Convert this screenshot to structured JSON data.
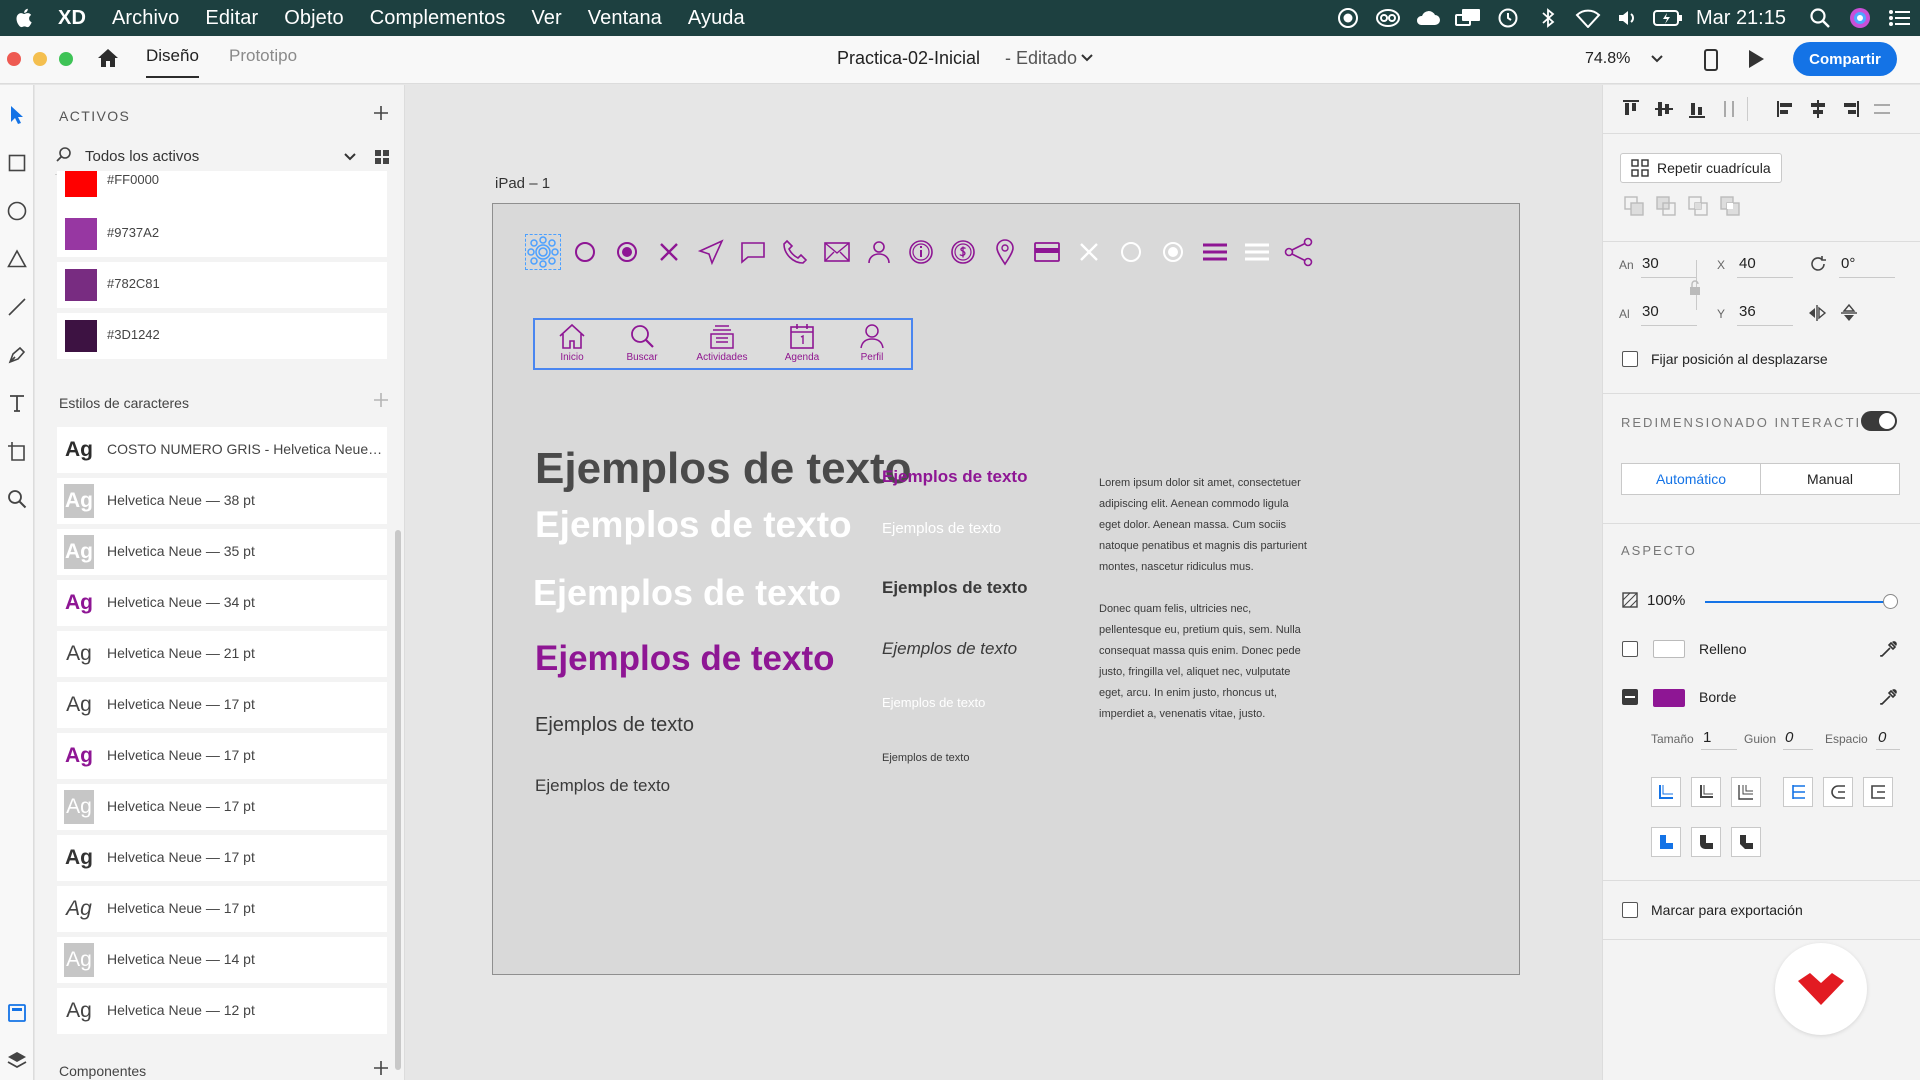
{
  "menubar": {
    "app": "XD",
    "items": [
      "Archivo",
      "Editar",
      "Objeto",
      "Complementos",
      "Ver",
      "Ventana",
      "Ayuda"
    ],
    "clock": "Mar 21:15"
  },
  "toolbar": {
    "tabs": {
      "design": "Diseño",
      "prototype": "Prototipo"
    },
    "document_title": "Practica-02-Inicial",
    "document_state": "- Editado",
    "zoom": "74.8%",
    "share_label": "Compartir"
  },
  "assets": {
    "title": "ACTIVOS",
    "filter": "Todos los activos",
    "colors": [
      {
        "hex": "#FF0000",
        "label": "#FF0000"
      },
      {
        "hex": "#9737A2",
        "label": "#9737A2"
      },
      {
        "hex": "#782C81",
        "label": "#782C81"
      },
      {
        "hex": "#3D1242",
        "label": "#3D1242"
      }
    ],
    "char_styles_title": "Estilos de caracteres",
    "char_styles": [
      {
        "ag": "Ag",
        "label": "COSTO NUMERO GRIS - Helvetica Neue…",
        "color": "#2c2c2c",
        "weight": "bold",
        "style": "normal",
        "bg": "#ffffff"
      },
      {
        "ag": "Ag",
        "label": "Helvetica Neue — 38 pt",
        "color": "#ffffff",
        "weight": "bold",
        "style": "normal",
        "bg": "#c6c6c6"
      },
      {
        "ag": "Ag",
        "label": "Helvetica Neue — 35 pt",
        "color": "#ffffff",
        "weight": "bold",
        "style": "normal",
        "bg": "#c6c6c6"
      },
      {
        "ag": "Ag",
        "label": "Helvetica Neue — 34 pt",
        "color": "#8e1694",
        "weight": "bold",
        "style": "normal",
        "bg": "#ffffff"
      },
      {
        "ag": "Ag",
        "label": "Helvetica Neue — 21 pt",
        "color": "#444444",
        "weight": "normal",
        "style": "normal",
        "bg": "#ffffff"
      },
      {
        "ag": "Ag",
        "label": "Helvetica Neue — 17 pt",
        "color": "#444444",
        "weight": "normal",
        "style": "normal",
        "bg": "#ffffff"
      },
      {
        "ag": "Ag",
        "label": "Helvetica Neue — 17 pt",
        "color": "#8e1694",
        "weight": "bold",
        "style": "normal",
        "bg": "#ffffff"
      },
      {
        "ag": "Ag",
        "label": "Helvetica Neue — 17 pt",
        "color": "#ffffff",
        "weight": "normal",
        "style": "normal",
        "bg": "#c6c6c6"
      },
      {
        "ag": "Ag",
        "label": "Helvetica Neue — 17 pt",
        "color": "#333333",
        "weight": "bold",
        "style": "normal",
        "bg": "#ffffff"
      },
      {
        "ag": "Ag",
        "label": "Helvetica Neue — 17 pt",
        "color": "#444444",
        "weight": "normal",
        "style": "italic",
        "bg": "#ffffff"
      },
      {
        "ag": "Ag",
        "label": "Helvetica Neue — 14 pt",
        "color": "#ffffff",
        "weight": "normal",
        "style": "normal",
        "bg": "#c6c6c6"
      },
      {
        "ag": "Ag",
        "label": "Helvetica Neue — 12 pt",
        "color": "#444444",
        "weight": "normal",
        "style": "normal",
        "bg": "#ffffff"
      }
    ],
    "components_title": "Componentes"
  },
  "artboard": {
    "name": "iPad – 1",
    "accent": "#8e1694",
    "icons": [
      "cluster-icon",
      "circle-outline-icon",
      "circle-filled-icon",
      "x-icon",
      "send-icon",
      "chat-icon",
      "phone-icon",
      "mail-icon",
      "user-icon",
      "info-icon",
      "dollar-icon",
      "pin-icon",
      "card-icon",
      "x-white-icon",
      "circle-white-icon",
      "radio-white-icon",
      "menu-icon",
      "menu-white-icon",
      "share-icon"
    ],
    "tabbar": [
      "Inicio",
      "Buscar",
      "Actividades",
      "Agenda",
      "Perfil"
    ],
    "samples_left": [
      "Ejemplos de texto",
      "Ejemplos de texto",
      "Ejemplos de texto",
      "Ejemplos de texto",
      "Ejemplos de texto",
      "Ejemplos de texto"
    ],
    "samples_mid": [
      "Ejemplos de texto",
      "Ejemplos de texto",
      "Ejemplos de texto",
      "Ejemplos de texto",
      "Ejemplos de texto",
      "Ejemplos de texto"
    ],
    "lorem_1": "Lorem ipsum dolor sit amet, consectetuer adipiscing elit. Aenean commodo ligula eget dolor. Aenean massa. Cum sociis natoque penatibus et magnis dis parturient montes, nascetur ridiculus mus.",
    "lorem_2": "Donec quam felis, ultricies nec, pellentesque eu, pretium quis, sem. Nulla consequat massa quis enim. Donec pede justo, fringilla vel, aliquet nec, vulputate eget, arcu. In enim justo, rhoncus ut, imperdiet a, venenatis vitae, justo."
  },
  "props": {
    "repeat_grid": "Repetir cuadrícula",
    "width_label": "An",
    "width": "30",
    "height_label": "Al",
    "height": "30",
    "x_label": "X",
    "x": "40",
    "y_label": "Y",
    "y": "36",
    "rotation": "0°",
    "fix_position": "Fijar posición al desplazarse",
    "responsive_title": "REDIMENSIONADO INTERACTIVO",
    "auto": "Automático",
    "manual": "Manual",
    "appearance_title": "ASPECTO",
    "opacity": "100%",
    "fill_label": "Relleno",
    "border_label": "Borde",
    "size_label": "Tamaño",
    "size": "1",
    "dash_label": "Guion",
    "dash": "0",
    "gap_label": "Espacio",
    "gap": "0",
    "export_label": "Marcar para exportación"
  }
}
